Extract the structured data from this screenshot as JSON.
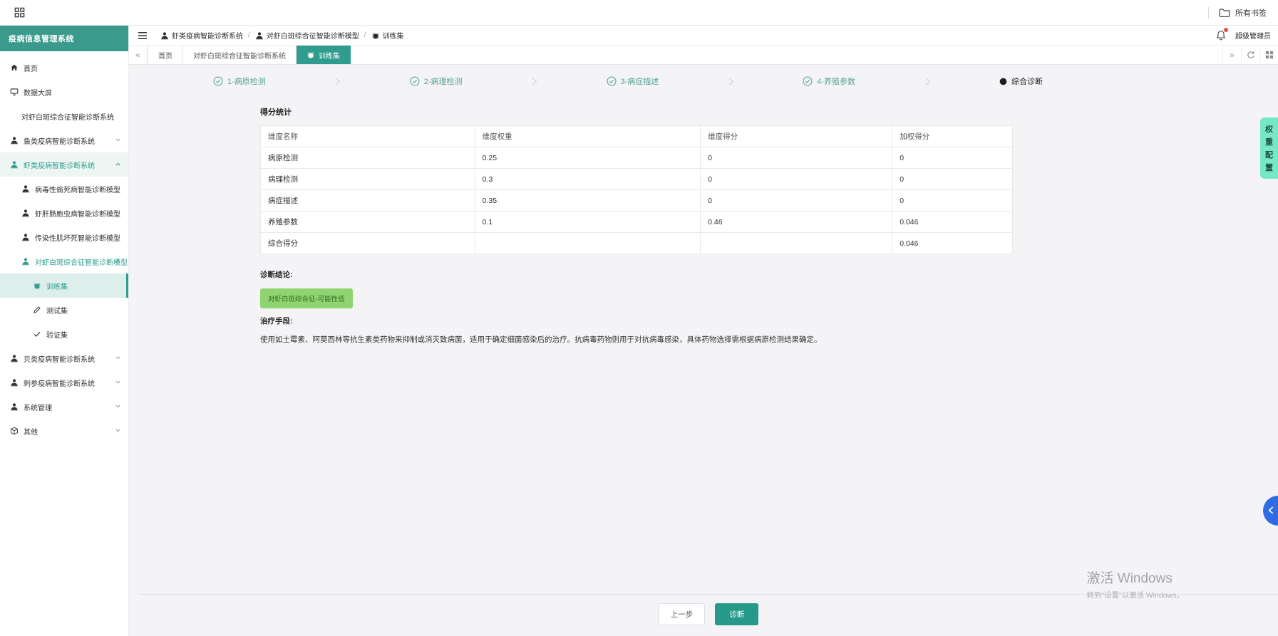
{
  "colors": {
    "accent_teal": "#2f9c8d",
    "sidebar_header_bg": "#3a9a8c",
    "active_item_bg": "#ddefeb",
    "mint_tab_bg": "#76e8c5",
    "badge_green_bg": "#8fd470",
    "badge_green_text": "#2f6a1c",
    "drawer_blue": "#2e6be5",
    "notification_red": "#e84b4b"
  },
  "bookmarks_bar": {
    "all_bookmarks_label": "所有书签"
  },
  "sidebar": {
    "title": "疫病信息管理系统",
    "items": [
      {
        "label": "首页",
        "icon": "home",
        "level": 1
      },
      {
        "label": "数据大屏",
        "icon": "monitor",
        "level": 1
      },
      {
        "label": "对虾白斑综合征智能诊断系统",
        "level": 2
      },
      {
        "label": "鱼类疫病智能诊断系统",
        "icon": "user",
        "level": 1,
        "chevron": "down"
      },
      {
        "label": "虾类疫病智能诊断系统",
        "icon": "user",
        "level": 1,
        "chevron": "up",
        "teal": true,
        "tint": true
      },
      {
        "label": "病毒性偷死病智能诊断模型",
        "icon": "user",
        "level": 2,
        "chevron": "down"
      },
      {
        "label": "虾肝肠胞虫病智能诊断模型",
        "icon": "user",
        "level": 2,
        "chevron": "down"
      },
      {
        "label": "传染性肌坏死智能诊断模型",
        "icon": "user",
        "level": 2,
        "chevron": "down"
      },
      {
        "label": "对虾白斑综合征智能诊断模型",
        "icon": "user",
        "level": 2,
        "chevron": "up",
        "teal": true
      },
      {
        "label": "训练集",
        "icon": "bug",
        "level": 3,
        "active": true,
        "teal": true
      },
      {
        "label": "测试集",
        "icon": "pencil",
        "level": 3
      },
      {
        "label": "验证集",
        "icon": "check",
        "level": 3
      },
      {
        "label": "贝类疫病智能诊断系统",
        "icon": "user",
        "level": 1,
        "chevron": "down"
      },
      {
        "label": "刺参疫病智能诊断系统",
        "icon": "user",
        "level": 1,
        "chevron": "down"
      },
      {
        "label": "系统管理",
        "icon": "user",
        "level": 1,
        "chevron": "down"
      },
      {
        "label": "其他",
        "icon": "box",
        "level": 1,
        "chevron": "down"
      }
    ]
  },
  "topbar": {
    "breadcrumb": [
      {
        "label": "虾类疫病智能诊断系统",
        "icon": "user"
      },
      {
        "label": "对虾白斑综合征智能诊断模型",
        "icon": "user"
      },
      {
        "label": "训练集",
        "icon": "bug"
      }
    ],
    "user_label": "超级管理员"
  },
  "tabbar": {
    "tabs": [
      {
        "label": "首页"
      },
      {
        "label": "对虾白斑综合征智能诊断系统"
      },
      {
        "label": "训练集",
        "active": true,
        "icon": "bug"
      }
    ]
  },
  "stepper": {
    "steps": [
      {
        "label": "1-病原检测",
        "state": "done"
      },
      {
        "label": "2-病理检测",
        "state": "done"
      },
      {
        "label": "3-病症描述",
        "state": "done"
      },
      {
        "label": "4-养殖参数",
        "state": "done"
      },
      {
        "label": "综合诊断",
        "state": "current"
      }
    ]
  },
  "score_section": {
    "title": "得分统计",
    "table": {
      "headers": [
        "维度名称",
        "维度权重",
        "维度得分",
        "加权得分"
      ],
      "rows": [
        [
          "病原检测",
          "0.25",
          "0",
          "0"
        ],
        [
          "病理检测",
          "0.3",
          "0",
          "0"
        ],
        [
          "病症描述",
          "0.35",
          "0",
          "0"
        ],
        [
          "养殖参数",
          "0.1",
          "0.46",
          "0.046"
        ],
        [
          "综合得分",
          "",
          "",
          "0.046"
        ]
      ]
    }
  },
  "diagnosis": {
    "conclusion_label": "诊断结论:",
    "conclusion_badge": "对虾白斑综合征-可能性低",
    "treatment_label": "治疗手段:",
    "treatment_text": "使用如土霉素、阿莫西林等抗生素类药物来抑制或消灭致病菌，适用于确定细菌感染后的治疗。抗病毒药物则用于对抗病毒感染，具体药物选择需根据病原检测结果确定。"
  },
  "footer": {
    "prev_label": "上一步",
    "diagnose_label": "诊断"
  },
  "right_edge": {
    "weight_config_label": "权重配置"
  },
  "watermark": {
    "line1": "激活 Windows",
    "line2": "转到“设置”以激活 Windows。"
  }
}
